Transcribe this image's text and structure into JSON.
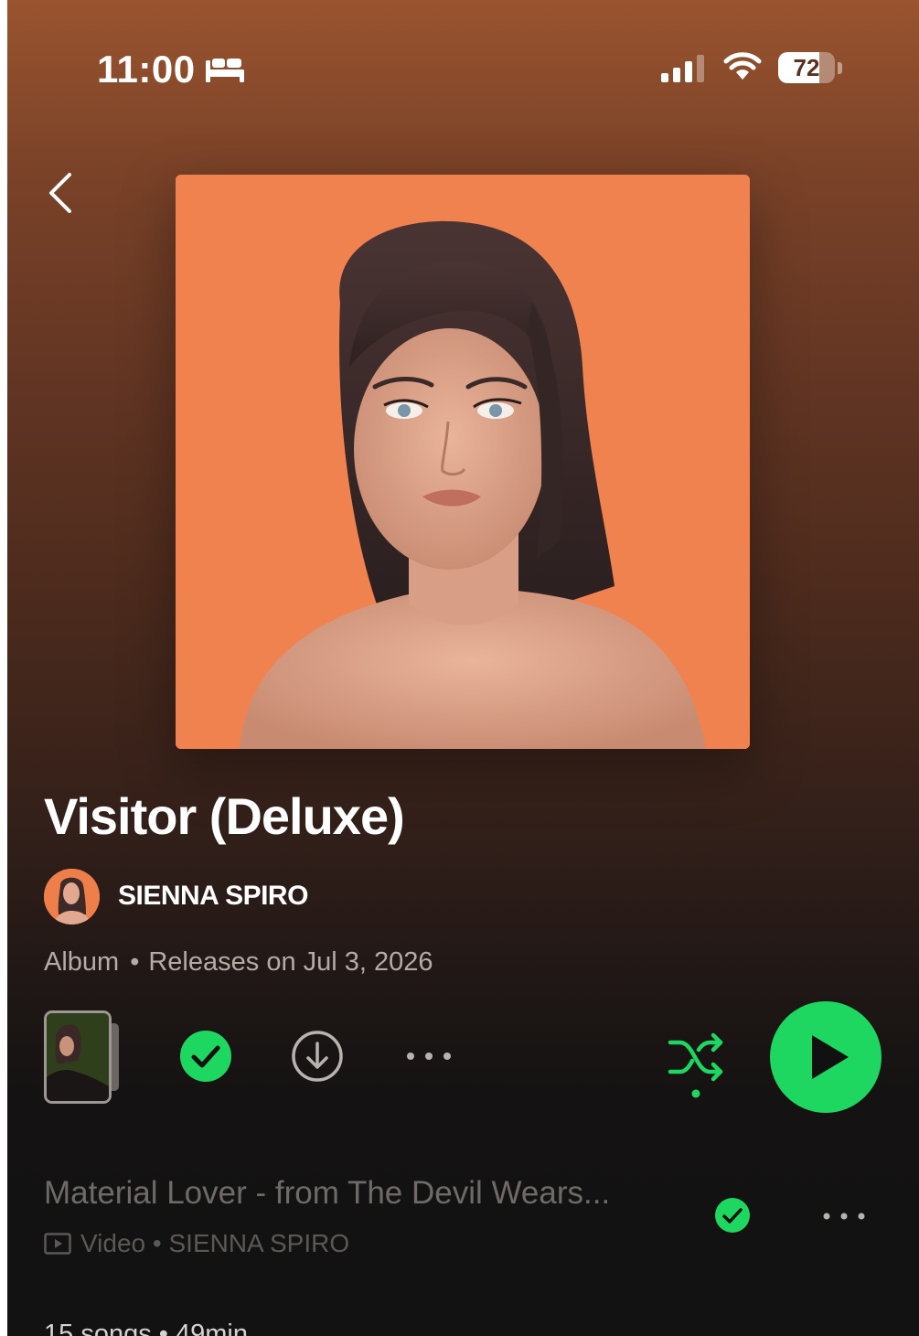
{
  "status_bar": {
    "time": "11:00",
    "battery_level": "72",
    "battery_fraction": 0.72
  },
  "album": {
    "title": "Visitor (Deluxe)",
    "artist": "SIENNA SPIRO",
    "type": "Album",
    "release": "Releases on Jul 3, 2026",
    "summary": "15 songs • 49min"
  },
  "colors": {
    "accent": "#1ed760",
    "cover_background": "#f08250"
  },
  "icons": {
    "back": "chevron-left-icon",
    "saved": "check-circle-icon",
    "download": "download-icon",
    "more": "more-icon",
    "shuffle": "shuffle-icon",
    "play": "play-icon",
    "video": "video-icon"
  },
  "track": {
    "title": "Material Lover - from The Devil Wears...",
    "type_label": "Video",
    "artist": "SIENNA SPIRO"
  }
}
